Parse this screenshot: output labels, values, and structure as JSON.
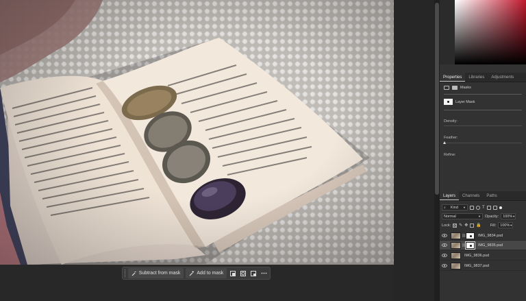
{
  "taskbar": {
    "subtract_label": "Subtract from mask",
    "add_label": "Add to mask"
  },
  "properties": {
    "tabs": [
      "Properties",
      "Libraries",
      "Adjustments"
    ],
    "masks_label": "Masks",
    "layer_mask_label": "Layer Mask",
    "density_label": "Density:",
    "feather_label": "Feather:",
    "refine_label": "Refine:"
  },
  "layers": {
    "tabs": [
      "Layers",
      "Channels",
      "Paths"
    ],
    "filter_value": "Kind",
    "blend_mode": "Normal",
    "opacity_label": "Opacity:",
    "opacity_value": "100%",
    "lock_label": "Lock:",
    "fill_label": "Fill:",
    "fill_value": "100%",
    "items": [
      {
        "name": "IMG_9834.psd",
        "has_mask": true,
        "selected": false
      },
      {
        "name": "IMG_9835.psd",
        "has_mask": true,
        "selected": true
      },
      {
        "name": "IMG_9836.psd",
        "has_mask": false,
        "selected": false
      },
      {
        "name": "IMG_9837.psd",
        "has_mask": false,
        "selected": false
      }
    ]
  },
  "colors": {
    "ui_background": "#282828",
    "panel": "#323232",
    "selected_row": "#474747",
    "picker_hue": "#c0182d"
  }
}
